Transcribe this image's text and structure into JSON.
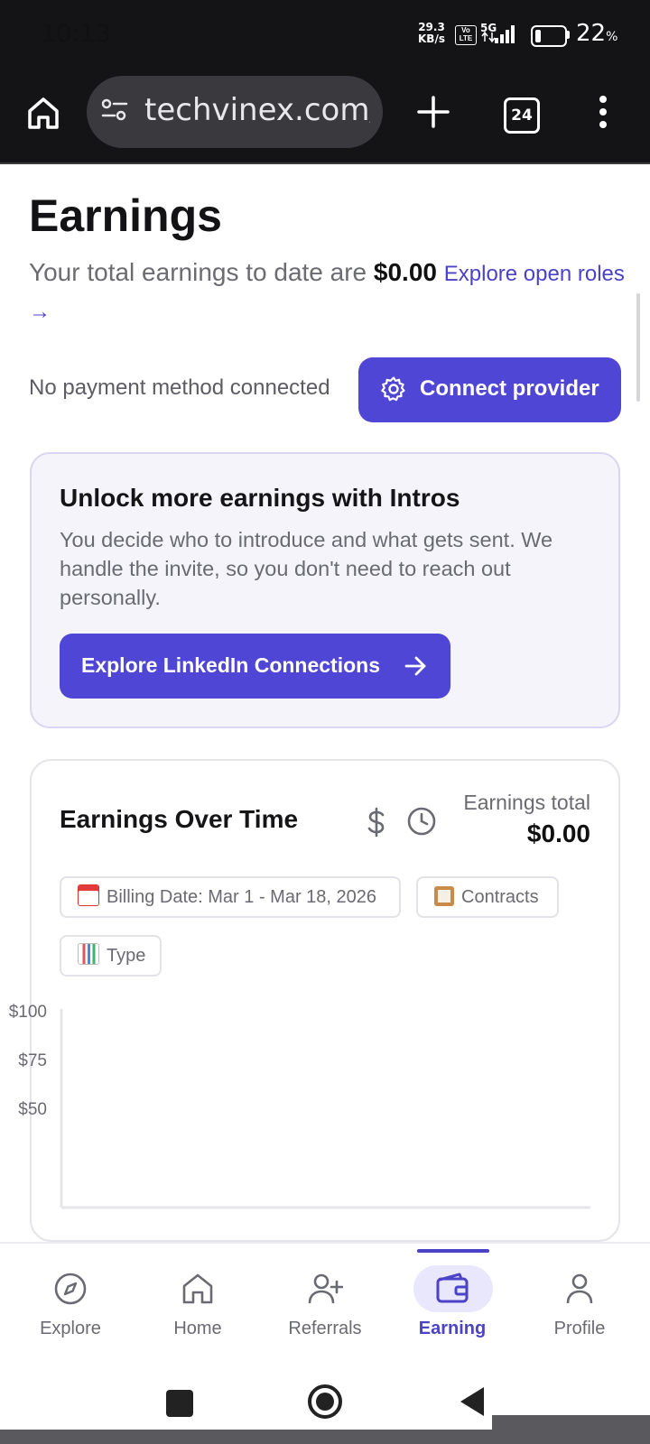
{
  "status_bar": {
    "time": "10:13",
    "net_speed_value": "29.3",
    "net_speed_unit": "KB/s",
    "volte_line1": "Vo",
    "volte_line2": "LTE",
    "network": "5G",
    "battery_percent": "22",
    "battery_unit": "%"
  },
  "browser": {
    "url": "techvinex.com/e",
    "tab_count": "24"
  },
  "page": {
    "title": "Earnings",
    "total_prefix": "Your total earnings to date are ",
    "total_amount": "$0.00",
    "explore_link": "Explore open roles →",
    "no_payment": "No payment method connected",
    "connect_button": "Connect provider"
  },
  "intros": {
    "title": "Unlock more earnings with Intros",
    "body": "You decide who to introduce and what gets sent. We handle the invite, so you don't need to reach out personally.",
    "button": "Explore LinkedIn Connections"
  },
  "chart_card": {
    "title": "Earnings Over Time",
    "total_label": "Earnings total",
    "total_value": "$0.00",
    "filters": {
      "billing": "Billing Date: Mar 1 - Mar 18, 2026",
      "contracts": "Contracts",
      "type": "Type"
    }
  },
  "chart_data": {
    "type": "line",
    "title": "",
    "xlabel": "",
    "ylabel": "",
    "y_tick_labels": [
      "$100",
      "$75",
      "$50"
    ],
    "y_ticks": [
      100,
      75,
      50
    ],
    "series": [],
    "grid": false
  },
  "bottom_nav": {
    "items": [
      {
        "label": "Explore",
        "icon": "compass-icon"
      },
      {
        "label": "Home",
        "icon": "home-icon"
      },
      {
        "label": "Referrals",
        "icon": "add-user-icon"
      },
      {
        "label": "Earning",
        "icon": "wallet-icon"
      },
      {
        "label": "Profile",
        "icon": "person-icon"
      }
    ],
    "active": "Earning"
  },
  "colors": {
    "accent": "#5046d6",
    "link": "#4b43c7",
    "card_bg": "#f4f4fa",
    "status_bar_bg": "#141416"
  }
}
